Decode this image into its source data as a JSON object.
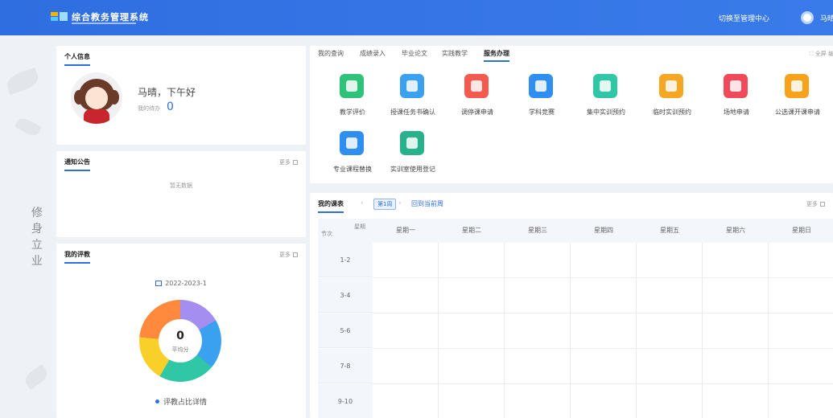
{
  "header": {
    "app_title": "综合教务管理系统",
    "switch_admin": "切换至管理中心",
    "user_name": "马晴"
  },
  "motto": [
    "修",
    "身",
    "立",
    "业"
  ],
  "profile": {
    "title": "个人信息",
    "greeting": "马晴，下午好",
    "todo_label": "我的待办",
    "todo_count": "0"
  },
  "notice": {
    "title": "通知公告",
    "more": "更多",
    "empty": "暂无数据"
  },
  "evaluation": {
    "title": "我的评教",
    "more": "更多",
    "term": "2022-2023-1",
    "score": "0",
    "score_label": "平均分",
    "detail": "评教占比详情",
    "ring_colors": [
      "#a48ff0",
      "#3aa0f0",
      "#2fc7a6",
      "#f9cf2a",
      "#ff8a3d"
    ]
  },
  "services": {
    "tabs": [
      "我的查询",
      "成绩录入",
      "毕业论文",
      "实践教学",
      "服务办理"
    ],
    "active_tab": "服务办理",
    "fullscreen": "全屏",
    "edit": "编辑",
    "items": [
      {
        "label": "教学评价",
        "icon": "chat-icon",
        "color": "#2fc37a"
      },
      {
        "label": "授课任务书确认",
        "icon": "checklist-icon",
        "color": "#3aa0f0"
      },
      {
        "label": "调停课申请",
        "icon": "edit-icon",
        "color": "#f45b4e"
      },
      {
        "label": "学科竞赛",
        "icon": "trophy-doc-icon",
        "color": "#2f8ff0"
      },
      {
        "label": "集中实训预约",
        "icon": "clock-icon",
        "color": "#2fc7a6"
      },
      {
        "label": "临时实训预约",
        "icon": "calendar-icon",
        "color": "#f5a623"
      },
      {
        "label": "场地申请",
        "icon": "layers-icon",
        "color": "#f04a5a"
      },
      {
        "label": "公选课开课申请",
        "icon": "person-icon",
        "color": "#f7a21b"
      },
      {
        "label": "专业课程替换",
        "icon": "refresh-icon",
        "color": "#2f8ff0"
      },
      {
        "label": "实训室使用登记",
        "icon": "register-icon",
        "color": "#27b28c"
      }
    ]
  },
  "timetable": {
    "title": "我的课表",
    "week": "第1周",
    "back_current": "回到当前周",
    "more": "更多",
    "corner_week": "星期",
    "corner_section": "节次",
    "days": [
      "星期一",
      "星期二",
      "星期三",
      "星期四",
      "星期五",
      "星期六",
      "星期日"
    ],
    "sections": [
      "1-2",
      "3-4",
      "5-6",
      "7-8",
      "9-10"
    ]
  }
}
